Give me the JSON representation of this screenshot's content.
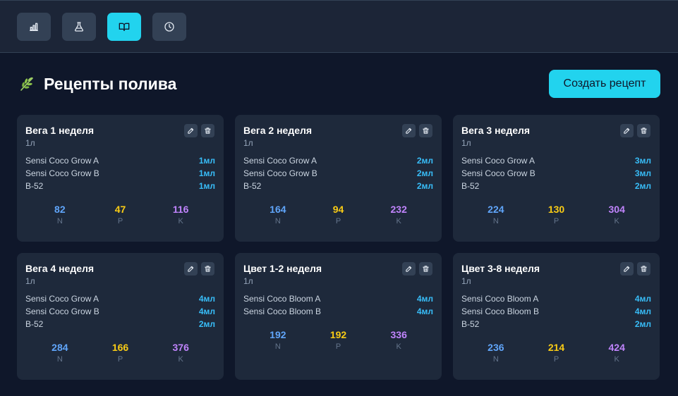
{
  "nav": [
    {
      "icon": "bar-chart-icon",
      "active": false
    },
    {
      "icon": "flask-icon",
      "active": false
    },
    {
      "icon": "book-icon",
      "active": true
    },
    {
      "icon": "clock-icon",
      "active": false
    }
  ],
  "header": {
    "title": "Рецепты полива",
    "leaf_icon": "leaf-icon",
    "create_label": "Создать рецепт"
  },
  "colors": {
    "accent": "#22d3ee",
    "n": "#60a5fa",
    "p": "#facc15",
    "k": "#c084fc",
    "amount": "#38bdf8"
  },
  "npk_labels": {
    "n": "N",
    "p": "P",
    "k": "K"
  },
  "recipes": [
    {
      "name": "Вега 1 неделя",
      "volume": "1л",
      "ingredients": [
        {
          "name": "Sensi Coco Grow A",
          "amount": "1мл"
        },
        {
          "name": "Sensi Coco Grow B",
          "amount": "1мл"
        },
        {
          "name": "B-52",
          "amount": "1мл"
        }
      ],
      "n": "82",
      "p": "47",
      "k": "116"
    },
    {
      "name": "Вега 2 неделя",
      "volume": "1л",
      "ingredients": [
        {
          "name": "Sensi Coco Grow A",
          "amount": "2мл"
        },
        {
          "name": "Sensi Coco Grow B",
          "amount": "2мл"
        },
        {
          "name": "B-52",
          "amount": "2мл"
        }
      ],
      "n": "164",
      "p": "94",
      "k": "232"
    },
    {
      "name": "Вега 3 неделя",
      "volume": "1л",
      "ingredients": [
        {
          "name": "Sensi Coco Grow A",
          "amount": "3мл"
        },
        {
          "name": "Sensi Coco Grow B",
          "amount": "3мл"
        },
        {
          "name": "B-52",
          "amount": "2мл"
        }
      ],
      "n": "224",
      "p": "130",
      "k": "304"
    },
    {
      "name": "Вега 4 неделя",
      "volume": "1л",
      "ingredients": [
        {
          "name": "Sensi Coco Grow A",
          "amount": "4мл"
        },
        {
          "name": "Sensi Coco Grow B",
          "amount": "4мл"
        },
        {
          "name": "B-52",
          "amount": "2мл"
        }
      ],
      "n": "284",
      "p": "166",
      "k": "376"
    },
    {
      "name": "Цвет 1-2 неделя",
      "volume": "1л",
      "ingredients": [
        {
          "name": "Sensi Coco Bloom A",
          "amount": "4мл"
        },
        {
          "name": "Sensi Coco Bloom B",
          "amount": "4мл"
        }
      ],
      "n": "192",
      "p": "192",
      "k": "336"
    },
    {
      "name": "Цвет 3-8 неделя",
      "volume": "1л",
      "ingredients": [
        {
          "name": "Sensi Coco Bloom A",
          "amount": "4мл"
        },
        {
          "name": "Sensi Coco Bloom B",
          "amount": "4мл"
        },
        {
          "name": "B-52",
          "amount": "2мл"
        }
      ],
      "n": "236",
      "p": "214",
      "k": "424"
    }
  ]
}
